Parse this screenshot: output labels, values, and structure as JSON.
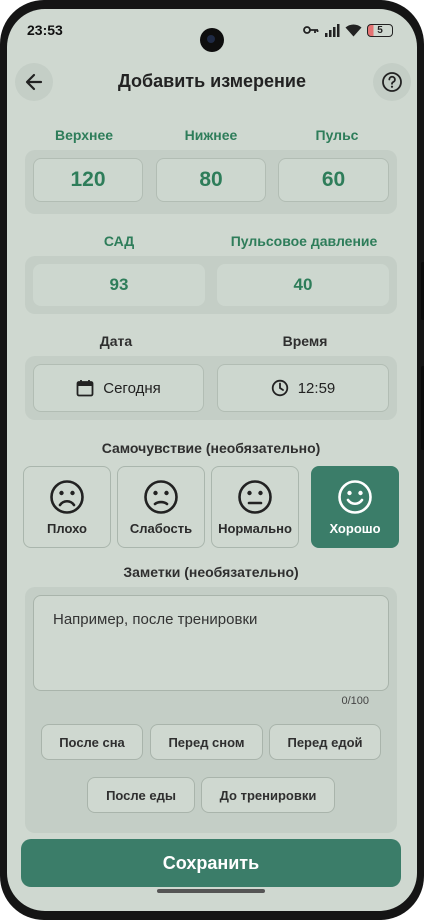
{
  "status_bar": {
    "time": "23:53",
    "battery": "5",
    "icons": [
      "key-icon",
      "signal-icon",
      "wifi-icon",
      "battery-icon"
    ]
  },
  "header": {
    "title": "Добавить измерение",
    "back_icon": "arrow-left-icon",
    "help_icon": "help-circle-icon"
  },
  "pressure": {
    "systolic_label": "Верхнее",
    "systolic_value": "120",
    "diastolic_label": "Нижнее",
    "diastolic_value": "80",
    "pulse_label": "Пульс",
    "pulse_value": "60"
  },
  "derived": {
    "map_label": "САД",
    "map_value": "93",
    "pulse_pressure_label": "Пульсовое давление",
    "pulse_pressure_value": "40"
  },
  "datetime": {
    "date_label": "Дата",
    "date_value": "Сегодня",
    "date_icon": "calendar-icon",
    "time_label": "Время",
    "time_value": "12:59",
    "time_icon": "clock-icon"
  },
  "wellbeing": {
    "label": "Самочувствие (необязательно)",
    "options": [
      {
        "label": "Плохо",
        "icon": "sad-face-icon"
      },
      {
        "label": "Слабость",
        "icon": "slightly-sad-face-icon"
      },
      {
        "label": "Нормально",
        "icon": "neutral-face-icon"
      },
      {
        "label": "Хорошо",
        "icon": "happy-face-icon"
      }
    ],
    "selected": "Хорошо"
  },
  "notes": {
    "label": "Заметки (необязательно)",
    "placeholder": "Например, после тренировки",
    "counter": "0/100",
    "chips": [
      "После сна",
      "Перед сном",
      "Перед едой",
      "После еды",
      "До тренировки"
    ]
  },
  "actions": {
    "save_label": "Сохранить"
  },
  "colors": {
    "accent": "#3b7d69",
    "accent_text": "#2e7d5a",
    "background": "#cfd8d0",
    "panel": "#c4cec6"
  }
}
